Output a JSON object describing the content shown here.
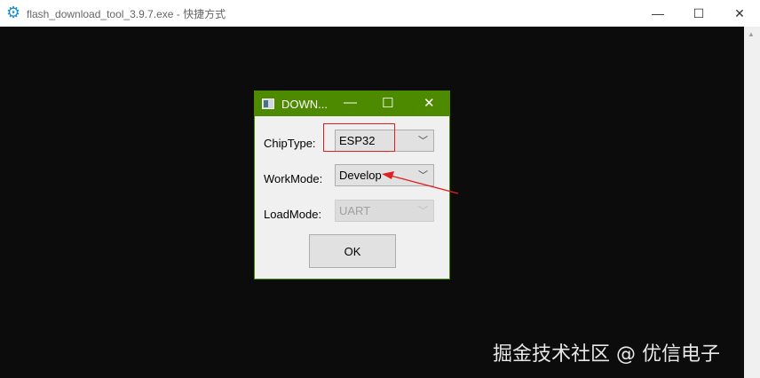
{
  "window": {
    "title": "flash_download_tool_3.9.7.exe - 快捷方式",
    "minimize": "—",
    "maximize": "☐",
    "close": "✕"
  },
  "dialog": {
    "title": "DOWN...",
    "minimize": "—",
    "maximize": "☐",
    "close": "✕",
    "chip_type": {
      "label": "ChipType:",
      "value": "ESP32"
    },
    "work_mode": {
      "label": "WorkMode:",
      "value": "Develop"
    },
    "load_mode": {
      "label": "LoadMode:",
      "value": "UART"
    },
    "ok_label": "OK"
  },
  "watermark": "掘金技术社区 @ 优信电子",
  "colors": {
    "dialog_title": "#4e8a00",
    "annotation": "#e02020"
  }
}
